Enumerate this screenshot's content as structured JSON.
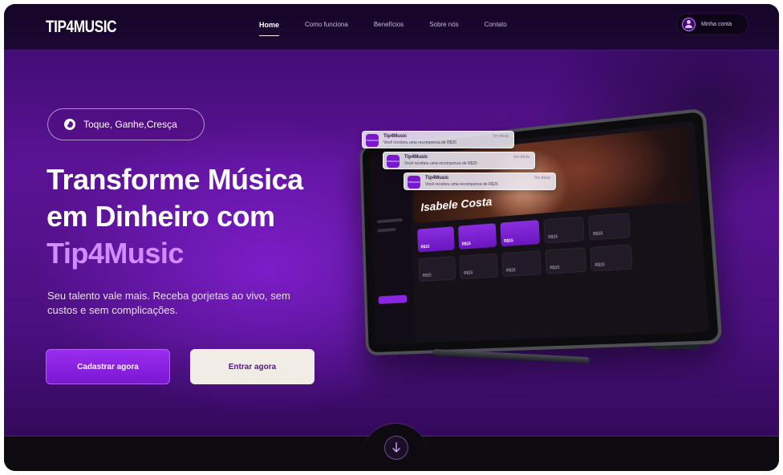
{
  "nav": {
    "logo": "TIP4MUSIC",
    "links": [
      "Home",
      "Como funciona",
      "Benefícios",
      "Sobre nós",
      "Contato"
    ],
    "active_link": "Home",
    "account_label": "Minha conta"
  },
  "hero": {
    "tag_label": "Toque, Ganhe,Cresça",
    "headline_line1": "Transforme Música",
    "headline_line2": "em Dinheiro com",
    "headline_line3": "Tip4Music",
    "subtext": "Seu talento vale mais. Receba gorjetas ao vivo, sem custos e sem complicações.",
    "primary_button": "Cadastrar agora",
    "secondary_button": "Entrar agora"
  },
  "tablet": {
    "artist_name": "Isabele Costa",
    "card_price": "R$15"
  },
  "notifications": [
    {
      "app": "Tip4Music",
      "time": "5m Atrás",
      "message": "Você recebeu uma recompensa de R$25",
      "icon_text": "TIP4MUSIC"
    },
    {
      "app": "Tip4Music",
      "time": "5m Atrás",
      "message": "Você recebeu uma recompensa de R$25",
      "icon_text": "TIP4MUSIC"
    },
    {
      "app": "Tip4Music",
      "time": "5m Atrás",
      "message": "Você recebeu uma recompensa de R$25",
      "icon_text": "TIP4MUSIC"
    }
  ],
  "colors": {
    "brand_purple": "#7a18d0",
    "accent_light": "#d38cff",
    "nav_bg": "#150525",
    "secondary_button_bg": "#f1ece6"
  },
  "icons": {
    "tag": "guitar-pick-icon",
    "account": "user-icon",
    "scroll": "arrow-down-icon"
  }
}
